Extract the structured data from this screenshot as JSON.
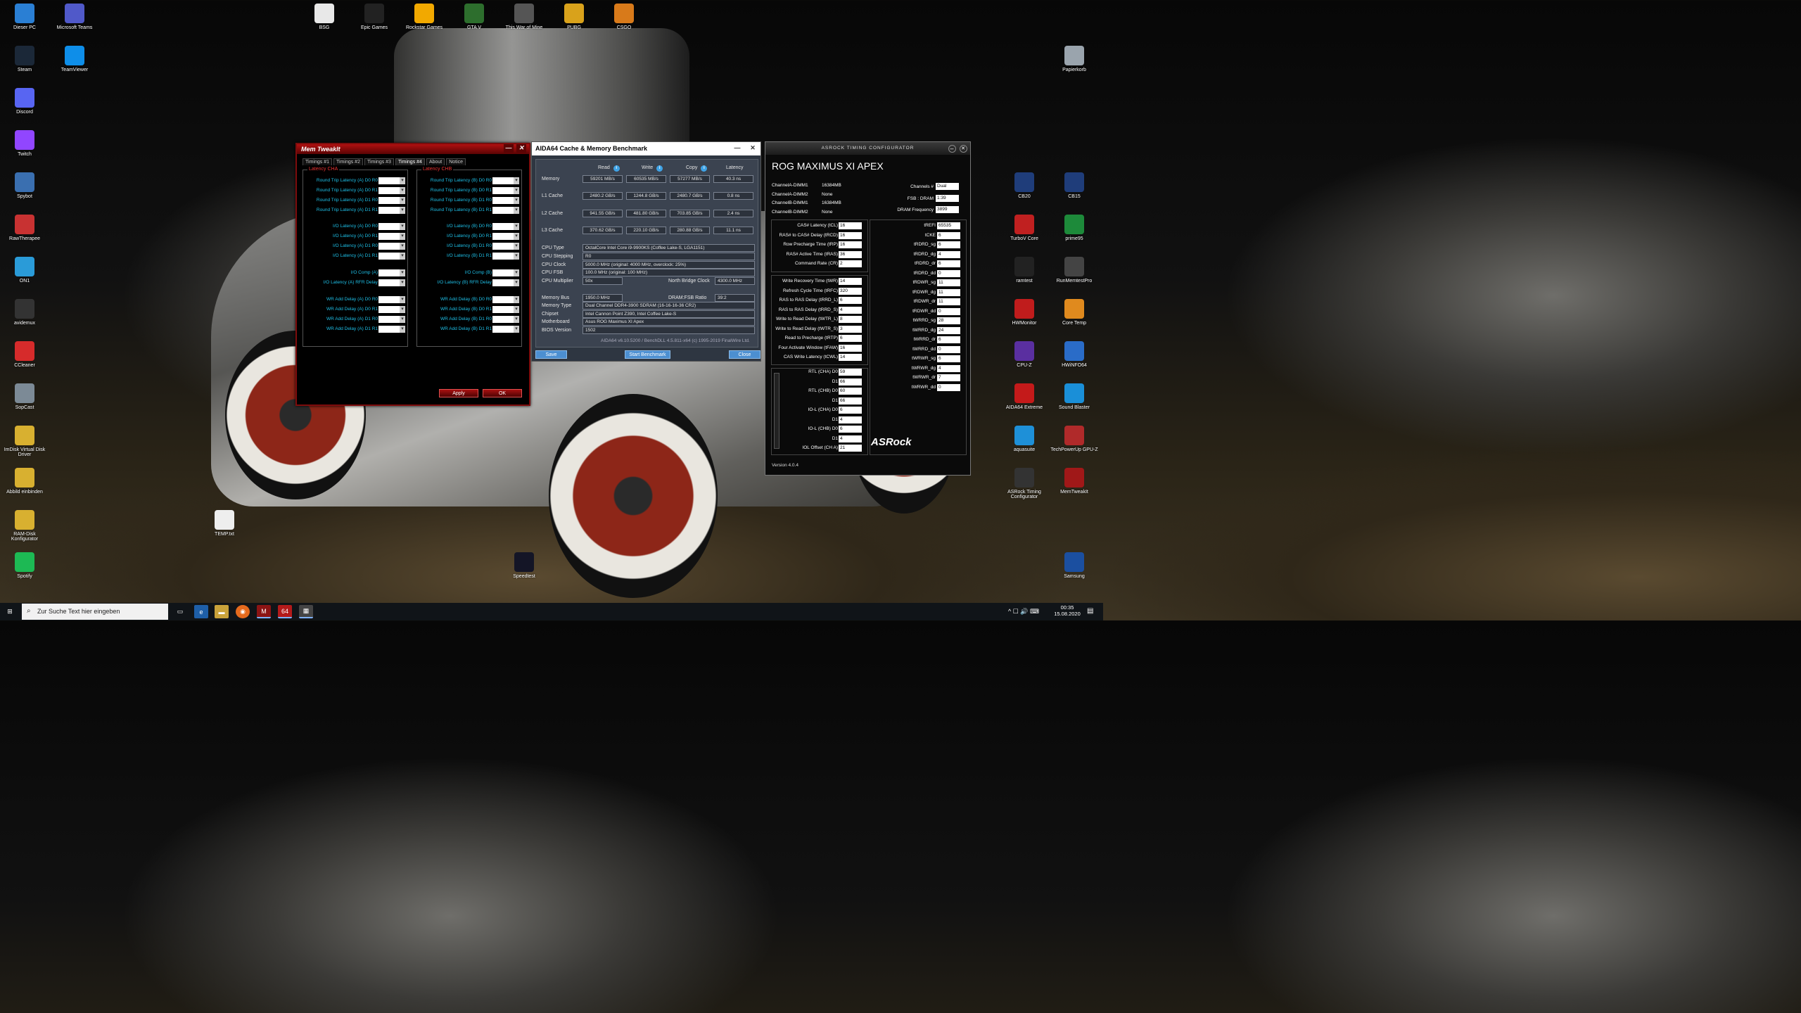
{
  "desktop_left": [
    {
      "label": "Dieser PC",
      "icon": "computer-icon",
      "color": "#2a7fd4"
    },
    {
      "label": "Microsoft Teams",
      "icon": "teams-icon",
      "color": "#5059c9"
    },
    {
      "label": "Steam",
      "icon": "steam-icon",
      "color": "#1b2838"
    },
    {
      "label": "TeamViewer",
      "icon": "teamviewer-icon",
      "color": "#0e8ee9"
    },
    {
      "label": "Discord",
      "icon": "discord-icon",
      "color": "#5865f2"
    },
    {
      "label": "Twitch",
      "icon": "twitch-icon",
      "color": "#9146ff"
    },
    {
      "label": "Spybot",
      "icon": "spybot-icon",
      "color": "#3a6fb0"
    },
    {
      "label": "RawTherapee",
      "icon": "rawtherapee-icon",
      "color": "#c83232"
    },
    {
      "label": "ON1",
      "icon": "on1-icon",
      "color": "#2a9bd8"
    },
    {
      "label": "avidemux",
      "icon": "avidemux-icon",
      "color": "#333333"
    },
    {
      "label": "CCleaner",
      "icon": "ccleaner-icon",
      "color": "#d62b2b"
    },
    {
      "label": "SopCast",
      "icon": "sopcast-icon",
      "color": "#7c8a96"
    },
    {
      "label": "ImDisk Virtual Disk Driver",
      "icon": "disk-icon",
      "color": "#d8b030"
    },
    {
      "label": "Abbild einbinden",
      "icon": "disk-icon",
      "color": "#d8b030"
    },
    {
      "label": "RAM-Disk Konfigurator",
      "icon": "disk-icon",
      "color": "#d8b030"
    },
    {
      "label": "Spotify",
      "icon": "spotify-icon",
      "color": "#1db954"
    }
  ],
  "desktop_top": [
    {
      "label": "BSG",
      "icon": "file-icon",
      "color": "#e8e8e8"
    },
    {
      "label": "Epic Games",
      "icon": "epic-icon",
      "color": "#222222"
    },
    {
      "label": "Rockstar Games",
      "icon": "rockstar-icon",
      "color": "#f2a900"
    },
    {
      "label": "GTA V",
      "icon": "gta-icon",
      "color": "#2d6e2d"
    },
    {
      "label": "This War of Mine",
      "icon": "twom-icon",
      "color": "#555555"
    },
    {
      "label": "PUBG",
      "icon": "pubg-icon",
      "color": "#d9a21b"
    },
    {
      "label": "CSGO",
      "icon": "csgo-icon",
      "color": "#d87a1a"
    }
  ],
  "desktop_right": [
    {
      "label": "Papierkorb",
      "icon": "recycle-bin-icon",
      "color": "#9aa4ad"
    },
    {
      "label": "CB20",
      "icon": "cinebench-icon",
      "color": "#1f3d7a"
    },
    {
      "label": "CB15",
      "icon": "cinebench-icon",
      "color": "#1f3d7a"
    },
    {
      "label": "TurboV Core",
      "icon": "turbov-icon",
      "color": "#c02020"
    },
    {
      "label": "prime95",
      "icon": "prime95-icon",
      "color": "#1d8a3a"
    },
    {
      "label": "ramtest",
      "icon": "ramtest-icon",
      "color": "#222222"
    },
    {
      "label": "RunMemtestPro",
      "icon": "memtest-icon",
      "color": "#444444"
    },
    {
      "label": "HWMonitor",
      "icon": "hwmonitor-icon",
      "color": "#c01c1c"
    },
    {
      "label": "Core Temp",
      "icon": "coretemp-icon",
      "color": "#e08a1e"
    },
    {
      "label": "CPU-Z",
      "icon": "cpuz-icon",
      "color": "#5a2fa0"
    },
    {
      "label": "HWiNFO64",
      "icon": "hwinfo-icon",
      "color": "#2a6cc8"
    },
    {
      "label": "AIDA64 Extreme",
      "icon": "aida64-icon",
      "color": "#c41a1a"
    },
    {
      "label": "Sound Blaster",
      "icon": "soundblaster-icon",
      "color": "#1a8fd8"
    },
    {
      "label": "aquasuite",
      "icon": "aquasuite-icon",
      "color": "#1e90d8"
    },
    {
      "label": "TechPowerUp GPU-Z",
      "icon": "gpuz-icon",
      "color": "#b02a2a"
    },
    {
      "label": "ASRock Timing Configurator",
      "icon": "asrock-icon",
      "color": "#333333"
    },
    {
      "label": "MemTweakIt",
      "icon": "memtweakit-icon",
      "color": "#a01818"
    },
    {
      "label": "Samsung",
      "icon": "samsung-icon",
      "color": "#1b4fa0"
    }
  ],
  "desktop_misc": [
    {
      "label": "TEMP.txt",
      "icon": "text-file-icon",
      "color": "#eeeeee"
    },
    {
      "label": "Speedtest",
      "icon": "speedtest-icon",
      "color": "#141526"
    }
  ],
  "memtweakit": {
    "title": "Mem TweakIt",
    "tabs": [
      "Timings #1",
      "Timings #2",
      "Timings #3",
      "Timings #4",
      "About",
      "Notice"
    ],
    "active_tab": "Timings #4",
    "cha": {
      "title": "Latency CHA",
      "rows": [
        {
          "label": "Round Trip Latency (A) D0 R0",
          "value": "59"
        },
        {
          "label": "Round Trip Latency (A) D0 R1",
          "value": "59"
        },
        {
          "label": "Round Trip Latency (A) D1 R0",
          "value": "66"
        },
        {
          "label": "Round Trip Latency (A) D1 R1",
          "value": "66"
        },
        {
          "label": "I/O Latency (A) D0 R0",
          "value": "6"
        },
        {
          "label": "I/O Latency (A) D0 R1",
          "value": "6"
        },
        {
          "label": "I/O Latency (A) D1 R0",
          "value": "4"
        },
        {
          "label": "I/O Latency (A) D1 R1",
          "value": "4"
        },
        {
          "label": "I/O Comp (A)",
          "value": "21"
        },
        {
          "label": "I/O Latency (A) RFR Delay",
          "value": "14"
        },
        {
          "label": "WR Add Delay (A) D0 R0",
          "value": "1"
        },
        {
          "label": "WR Add Delay (A) D0 R1",
          "value": "1"
        },
        {
          "label": "WR Add Delay (A) D1 R0",
          "value": "0"
        },
        {
          "label": "WR Add Delay (A) D1 R1",
          "value": "0"
        }
      ]
    },
    "chb": {
      "title": "Latency CHB",
      "rows": [
        {
          "label": "Round Trip Latency (B) D0 R0",
          "value": "60"
        },
        {
          "label": "Round Trip Latency (B) D0 R1",
          "value": "60"
        },
        {
          "label": "Round Trip Latency (B) D1 R0",
          "value": "66"
        },
        {
          "label": "Round Trip Latency (B) D1 R1",
          "value": "66"
        },
        {
          "label": "I/O Latency (B) D0 R0",
          "value": "6"
        },
        {
          "label": "I/O Latency (B) D0 R1",
          "value": "6"
        },
        {
          "label": "I/O Latency (B) D1 R0",
          "value": "4"
        },
        {
          "label": "I/O Latency (B) D1 R1",
          "value": "4"
        },
        {
          "label": "I/O Comp (B)",
          "value": "21"
        },
        {
          "label": "I/O Latency (B) RFR Delay",
          "value": "14"
        },
        {
          "label": "WR Add Delay (B) D0 R0",
          "value": "1"
        },
        {
          "label": "WR Add Delay (B) D0 R1",
          "value": "1"
        },
        {
          "label": "WR Add Delay (B) D1 R0",
          "value": "0"
        },
        {
          "label": "WR Add Delay (B) D1 R1",
          "value": "0"
        }
      ]
    },
    "apply_label": "Apply",
    "ok_label": "OK"
  },
  "aida": {
    "title": "AIDA64 Cache & Memory Benchmark",
    "headers": [
      "Read",
      "Write",
      "Copy",
      "Latency"
    ],
    "rows": [
      {
        "label": "Memory",
        "read": "59201 MB/s",
        "write": "60535 MB/s",
        "copy": "57277 MB/s",
        "latency": "40.3 ns"
      },
      {
        "label": "L1 Cache",
        "read": "2480.2 GB/s",
        "write": "1244.8 GB/s",
        "copy": "2480.7 GB/s",
        "latency": "0.8 ns"
      },
      {
        "label": "L2 Cache",
        "read": "941.55 GB/s",
        "write": "481.80 GB/s",
        "copy": "703.85 GB/s",
        "latency": "2.4 ns"
      },
      {
        "label": "L3 Cache",
        "read": "370.62 GB/s",
        "write": "220.10 GB/s",
        "copy": "280.88 GB/s",
        "latency": "11.1 ns"
      }
    ],
    "cpu_type_label": "CPU Type",
    "cpu_type": "OctalCore Intel Core i9-9900KS  (Coffee Lake-S, LGA1151)",
    "cpu_stepping_label": "CPU Stepping",
    "cpu_stepping": "R0",
    "cpu_clock_label": "CPU Clock",
    "cpu_clock": "5000.0 MHz  (original: 4000 MHz, overclock: 25%)",
    "cpu_fsb_label": "CPU FSB",
    "cpu_fsb": "100.0 MHz  (original: 100 MHz)",
    "cpu_mult_label": "CPU Multiplier",
    "cpu_mult": "50x",
    "nb_clock_label": "North Bridge Clock",
    "nb_clock": "4300.0 MHz",
    "mem_bus_label": "Memory Bus",
    "mem_bus": "1950.0 MHz",
    "dram_ratio_label": "DRAM:FSB Ratio",
    "dram_ratio": "39:2",
    "mem_type_label": "Memory Type",
    "mem_type": "Dual Channel DDR4-3900 SDRAM  (16-16-16-36 CR2)",
    "chipset_label": "Chipset",
    "chipset": "Intel Cannon Point Z390, Intel Coffee Lake-S",
    "mobo_label": "Motherboard",
    "mobo": "Asus ROG Maximus XI Apex",
    "bios_label": "BIOS Version",
    "bios": "1502",
    "footer": "AIDA64 v6.10.5200 / BenchDLL 4.5.811-x64  (c) 1995-2019 FinalWire Ltd.",
    "save_label": "Save",
    "start_label": "Start Benchmark",
    "close_label": "Close"
  },
  "asrock": {
    "title": "ASRock Timing Configurator",
    "model": "ROG MAXIMUS XI APEX",
    "dimms": [
      {
        "label": "ChannelA-DIMM1",
        "value": "16384MB"
      },
      {
        "label": "ChannelA-DIMM2",
        "value": "None"
      },
      {
        "label": "ChannelB-DIMM1",
        "value": "16384MB"
      },
      {
        "label": "ChannelB-DIMM2",
        "value": "None"
      }
    ],
    "channels_label": "Channels #",
    "channels": "Dual",
    "fsb_label": "FSB : DRAM",
    "fsb": "1:39",
    "dram_freq_label": "DRAM Frequency",
    "dram_freq": "3899",
    "primary": [
      {
        "label": "CAS# Latency (tCL)",
        "value": "16"
      },
      {
        "label": "RAS# to CAS# Delay (tRCD)",
        "value": "16"
      },
      {
        "label": "Row Precharge Time (tRP)",
        "value": "16"
      },
      {
        "label": "RAS# Active Time (tRAS)",
        "value": "36"
      },
      {
        "label": "Command Rate (CR)",
        "value": "2"
      }
    ],
    "secondary": [
      {
        "label": "Write Recovery Time (tWR)",
        "value": "14"
      },
      {
        "label": "Refresh Cycle Time (tRFC)",
        "value": "320"
      },
      {
        "label": "RAS to RAS Delay (tRRD_L)",
        "value": "6"
      },
      {
        "label": "RAS to RAS Delay (tRRD_S)",
        "value": "4"
      },
      {
        "label": "Write to Read Delay (tWTR_L)",
        "value": "8"
      },
      {
        "label": "Write to Read Delay (tWTR_S)",
        "value": "3"
      },
      {
        "label": "Read to Precharge (tRTP)",
        "value": "6"
      },
      {
        "label": "Four Activate Window (tFAW)",
        "value": "16"
      },
      {
        "label": "CAS Write Latency (tCWL)",
        "value": "14"
      }
    ],
    "rtl": [
      {
        "label": "RTL (CHA) D0",
        "value": "59"
      },
      {
        "label": "D1",
        "value": "66"
      },
      {
        "label": "RTL (CHB) D0",
        "value": "60"
      },
      {
        "label": "D1",
        "value": "66"
      },
      {
        "label": "IO-L (CHA) D0",
        "value": "6"
      },
      {
        "label": "D1",
        "value": "4"
      },
      {
        "label": "IO-L (CHB) D0",
        "value": "6"
      },
      {
        "label": "D1",
        "value": "4"
      },
      {
        "label": "IOL Offset (CH A)",
        "value": "21"
      }
    ],
    "right": [
      {
        "label": "tREFI",
        "value": "65535"
      },
      {
        "label": "tCKE",
        "value": "6"
      },
      {
        "label": "tRDRD_sg",
        "value": "6"
      },
      {
        "label": "tRDRD_dg",
        "value": "4"
      },
      {
        "label": "tRDRD_dr",
        "value": "6"
      },
      {
        "label": "tRDRD_dd",
        "value": "0"
      },
      {
        "label": "tRDWR_sg",
        "value": "11"
      },
      {
        "label": "tRDWR_dg",
        "value": "11"
      },
      {
        "label": "tRDWR_dr",
        "value": "11"
      },
      {
        "label": "tRDWR_dd",
        "value": "0"
      },
      {
        "label": "tWRRD_sg",
        "value": "28"
      },
      {
        "label": "tWRRD_dg",
        "value": "24"
      },
      {
        "label": "tWRRD_dr",
        "value": "6"
      },
      {
        "label": "tWRRD_dd",
        "value": "0"
      },
      {
        "label": "tWRWR_sg",
        "value": "6"
      },
      {
        "label": "tWRWR_dg",
        "value": "4"
      },
      {
        "label": "tWRWR_dr",
        "value": "7"
      },
      {
        "label": "tWRWR_dd",
        "value": "0"
      }
    ],
    "brand": "ASRock",
    "version": "Version 4.0.4"
  },
  "taskbar": {
    "search_placeholder": "Zur Suche Text hier eingeben",
    "time": "00:35",
    "date": "15.08.2020"
  }
}
